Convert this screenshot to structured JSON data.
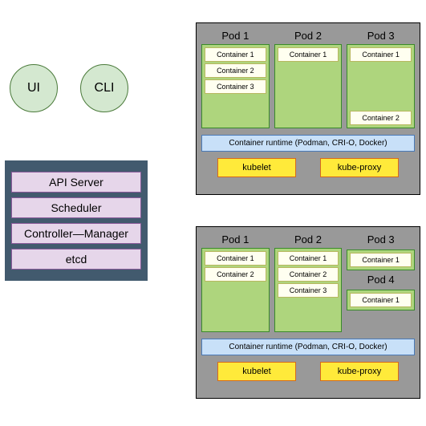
{
  "clients": {
    "ui": "UI",
    "cli": "CLI"
  },
  "master": {
    "api_server": "API Server",
    "scheduler": "Scheduler",
    "controller_manager": "Controller—Manager",
    "etcd": "etcd"
  },
  "worker1": {
    "pod1": {
      "label": "Pod 1",
      "containers": [
        "Container 1",
        "Container 2",
        "Container 3"
      ]
    },
    "pod2": {
      "label": "Pod 2",
      "containers": [
        "Container 1"
      ]
    },
    "pod3": {
      "label": "Pod 3",
      "containers": [
        "Container 1",
        "Container 2"
      ]
    },
    "runtime": "Container runtime (Podman, CRI-O, Docker)",
    "kubelet": "kubelet",
    "kube_proxy": "kube-proxy"
  },
  "worker2": {
    "pod1": {
      "label": "Pod 1",
      "containers": [
        "Container 1",
        "Container 2"
      ]
    },
    "pod2": {
      "label": "Pod 2",
      "containers": [
        "Container 1",
        "Container 2",
        "Container 3"
      ]
    },
    "pod3": {
      "label": "Pod 3",
      "containers": [
        "Container 1"
      ]
    },
    "pod4": {
      "label": "Pod 4",
      "containers": [
        "Container 1"
      ]
    },
    "runtime": "Container runtime (Podman, CRI-O, Docker)",
    "kubelet": "kubelet",
    "kube_proxy": "kube-proxy"
  }
}
